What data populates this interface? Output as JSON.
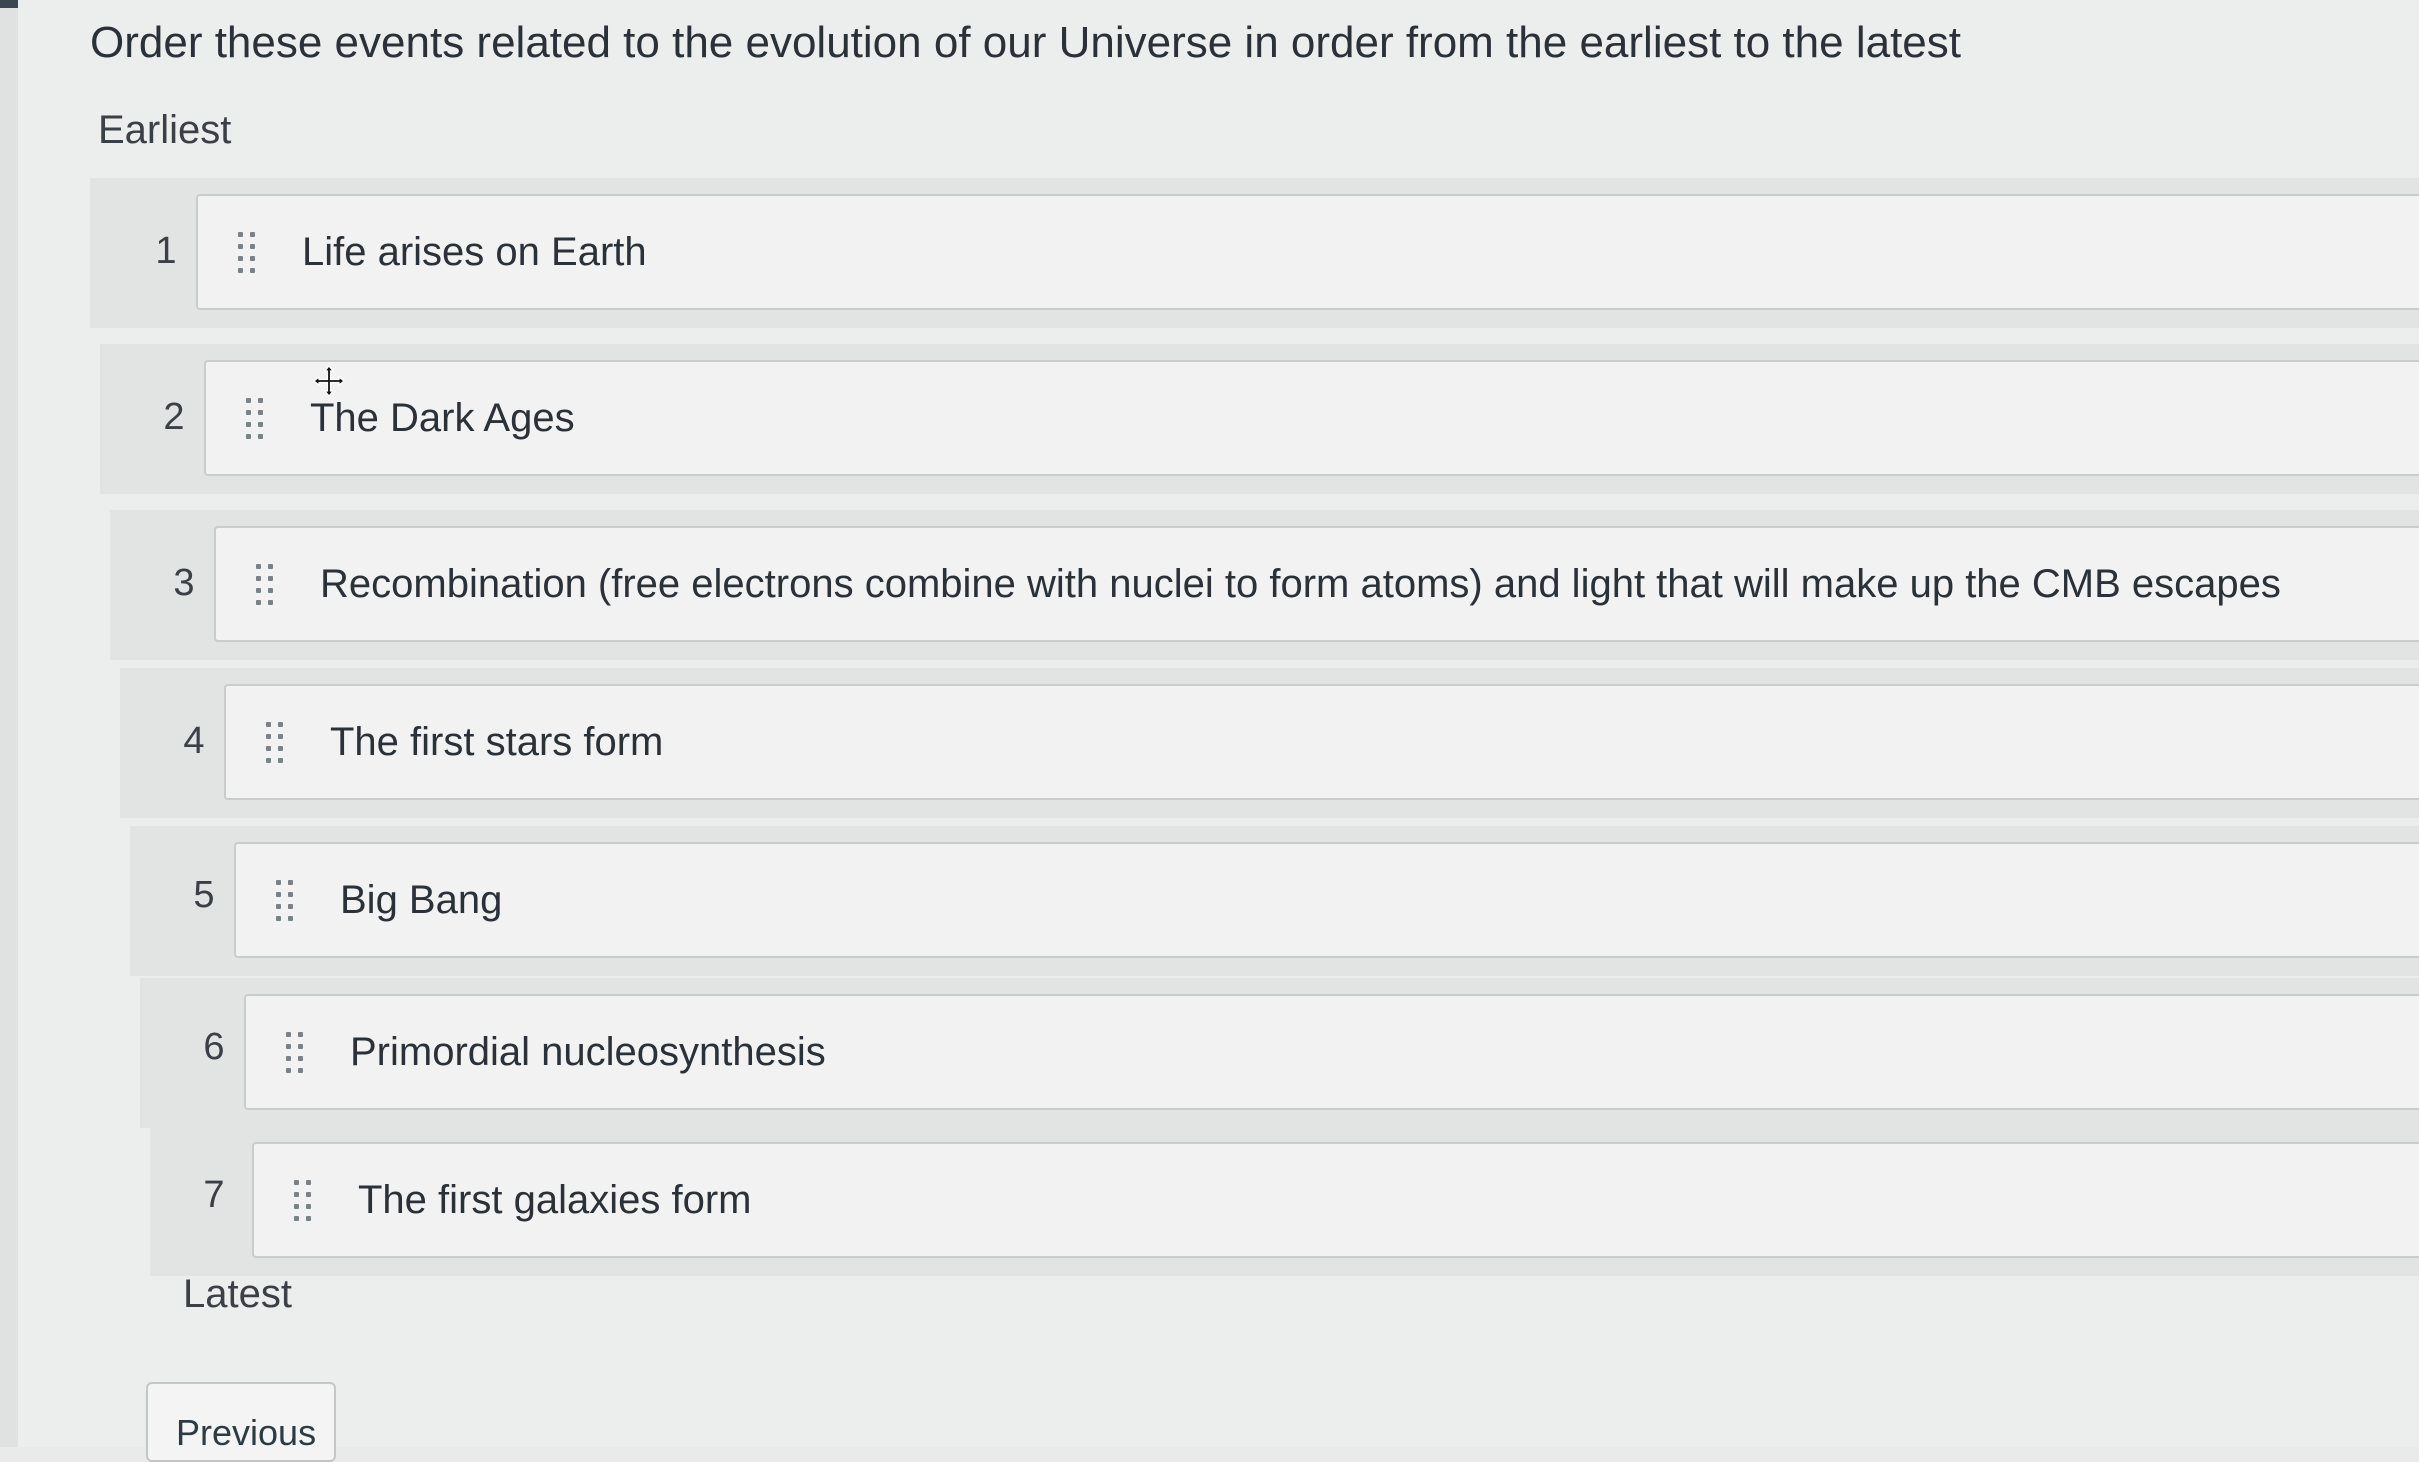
{
  "question": {
    "prompt": "Order these events related to the evolution of our Universe in order from the earliest to the latest"
  },
  "ordering": {
    "earliest_label": "Earliest",
    "latest_label": "Latest",
    "items": [
      {
        "number": "1",
        "label": "Life arises on Earth",
        "icon": "drag-handle-icon"
      },
      {
        "number": "2",
        "label": "The Dark Ages",
        "icon": "drag-handle-icon"
      },
      {
        "number": "3",
        "label": "Recombination (free electrons combine with nuclei to form atoms) and light that will make up the CMB escapes",
        "icon": "drag-handle-icon"
      },
      {
        "number": "4",
        "label": "The first stars form",
        "icon": "drag-handle-icon"
      },
      {
        "number": "5",
        "label": "Big Bang",
        "icon": "drag-handle-icon"
      },
      {
        "number": "6",
        "label": "Primordial nucleosynthesis",
        "icon": "drag-handle-icon"
      },
      {
        "number": "7",
        "label": "The first galaxies form",
        "icon": "drag-handle-icon"
      }
    ]
  },
  "navigation": {
    "previous_label": "Previous"
  },
  "colors": {
    "background": "#eceeed",
    "item_background": "#f1f2f1",
    "text": "#2b3138"
  }
}
